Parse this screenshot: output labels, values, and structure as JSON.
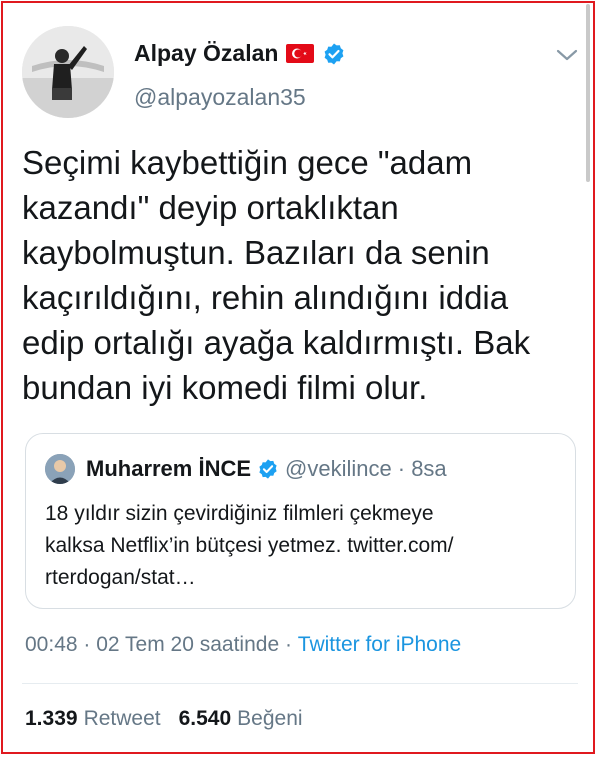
{
  "tweet": {
    "author_name": "Alpay Özalan",
    "author_handle": "@alpayozalan35",
    "text_lines": [
      "Seçimi kaybettiğin gece \"adam",
      "kazandı\" deyip ortaklıktan",
      "kaybolmuştun. Bazıları da senin",
      "kaçırıldığını, rehin alındığını iddia",
      "edip ortalığı ayağa kaldırmıştı. Bak",
      "bundan iyi komedi filmi olur."
    ],
    "flag_icon": "turkey-flag-icon",
    "verified_icon": "verified-badge-icon"
  },
  "quote": {
    "author_name": "Muharrem İNCE",
    "author_handle": "@vekilince",
    "time": "· 8sa",
    "text_lines": [
      "18 yıldır sizin çevirdiğiniz filmleri çekmeye",
      "kalksa Netflix’in bütçesi yetmez. twitter.com/",
      "rterdogan/stat…"
    ]
  },
  "meta": {
    "time": "00:48 · 02 Tem 20 saatinde · ",
    "source": "Twitter for iPhone"
  },
  "stats": {
    "retweets_count": "1.339",
    "retweets_label": "Retweet",
    "likes_count": "6.540",
    "likes_label": "Beğeni"
  },
  "colors": {
    "accent": "#1da1f2",
    "link": "#1b95e0",
    "secondary_text": "#657786",
    "frame": "#e0191f"
  }
}
